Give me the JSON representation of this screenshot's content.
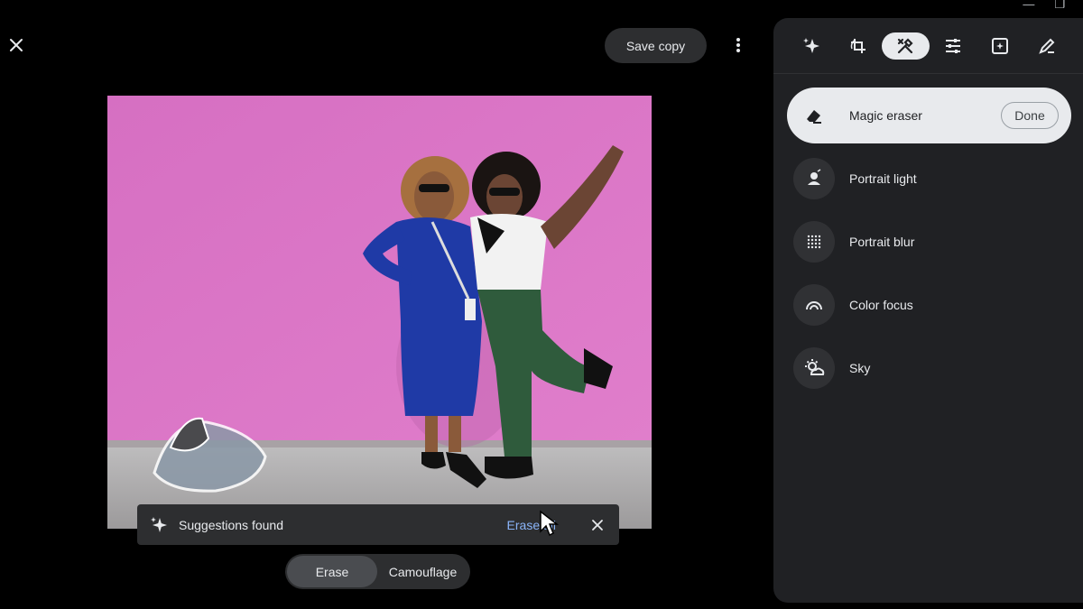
{
  "window": {
    "minimize_glyph": "—",
    "restore_glyph": "❐"
  },
  "topbar": {
    "save_copy_label": "Save copy",
    "close_icon": "close-icon",
    "more_icon": "more-vert-icon"
  },
  "photo": {
    "description_icon": "photo-image"
  },
  "suggestions": {
    "text": "Suggestions found",
    "erase_all_label": "Erase all"
  },
  "mode_toggle": {
    "erase_label": "Erase",
    "camouflage_label": "Camouflage",
    "selected": "Erase"
  },
  "panel": {
    "tools": [
      {
        "icon": "sparkle-icon",
        "active": false
      },
      {
        "icon": "crop-rotate-icon",
        "active": false
      },
      {
        "icon": "tools-icon",
        "active": true
      },
      {
        "icon": "sliders-icon",
        "active": false
      },
      {
        "icon": "filter-icon",
        "active": false
      },
      {
        "icon": "markup-pen-icon",
        "active": false
      }
    ],
    "items": [
      {
        "label": "Magic eraser",
        "icon": "eraser-icon",
        "active": true,
        "done_label": "Done"
      },
      {
        "label": "Portrait light",
        "icon": "portrait-light-icon"
      },
      {
        "label": "Portrait blur",
        "icon": "portrait-blur-icon"
      },
      {
        "label": "Color focus",
        "icon": "color-focus-icon"
      },
      {
        "label": "Sky",
        "icon": "sky-icon"
      }
    ]
  },
  "colors": {
    "accent_link": "#8ab4f8",
    "panel_bg": "#202124",
    "wall_pink": "#d774c4"
  }
}
